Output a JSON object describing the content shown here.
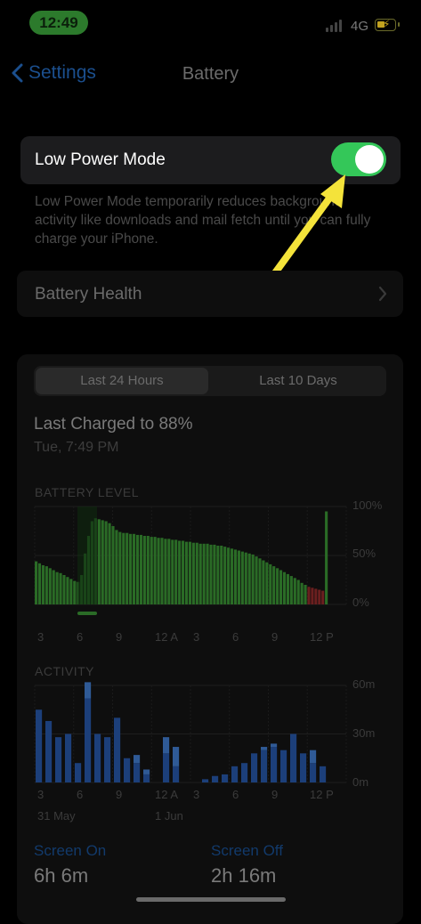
{
  "status": {
    "time": "12:49",
    "network": "4G"
  },
  "nav": {
    "back_label": "Settings",
    "title": "Battery"
  },
  "low_power": {
    "label": "Low Power Mode",
    "enabled": true,
    "description": "Low Power Mode temporarily reduces background activity like downloads and mail fetch until you can fully charge your iPhone."
  },
  "battery_health": {
    "label": "Battery Health"
  },
  "tabs": [
    "Last 24 Hours",
    "Last 10 Days"
  ],
  "last_charged": {
    "title": "Last Charged to 88%",
    "time": "Tue, 7:49 PM"
  },
  "battery_level": {
    "title": "BATTERY LEVEL",
    "y_ticks": [
      "100%",
      "50%",
      "0%"
    ]
  },
  "activity": {
    "title": "ACTIVITY",
    "y_ticks": [
      "60m",
      "30m",
      "0m"
    ]
  },
  "x_ticks": [
    "3",
    "6",
    "9",
    "12 A",
    "3",
    "6",
    "9",
    "12 P"
  ],
  "dates": [
    "31 May",
    "1 Jun"
  ],
  "screen_on": {
    "label": "Screen On",
    "value": "6h 6m"
  },
  "screen_off": {
    "label": "Screen Off",
    "value": "2h 16m"
  },
  "colors": {
    "green": "#2a6b26",
    "red": "#6b1f1f",
    "blue": "#1c3f7a",
    "blue_light": "#2f5a96",
    "toggle": "#34c759",
    "arrow": "#f4e33a"
  },
  "chart_data": [
    {
      "type": "bar",
      "title": "BATTERY LEVEL",
      "x_ticks": [
        "3",
        "6",
        "9",
        "12 A",
        "3",
        "6",
        "9",
        "12 P"
      ],
      "ylim": [
        0,
        100
      ],
      "values": [
        44,
        42,
        40,
        39,
        37,
        35,
        33,
        32,
        30,
        28,
        26,
        24,
        23,
        30,
        52,
        70,
        85,
        88,
        87,
        86,
        85,
        83,
        80,
        76,
        74,
        73,
        73,
        72,
        72,
        71,
        71,
        70,
        70,
        69,
        69,
        68,
        68,
        67,
        67,
        66,
        66,
        65,
        65,
        64,
        64,
        63,
        63,
        62,
        62,
        62,
        61,
        61,
        60,
        60,
        59,
        58,
        57,
        56,
        55,
        54,
        53,
        52,
        51,
        49,
        47,
        45,
        43,
        41,
        39,
        37,
        35,
        33,
        31,
        29,
        27,
        25,
        22,
        20,
        18,
        17,
        16,
        15,
        14,
        95
      ]
    },
    {
      "type": "bar",
      "title": "ACTIVITY",
      "x_ticks": [
        "3",
        "6",
        "9",
        "12 A",
        "3",
        "6",
        "9",
        "12 P"
      ],
      "ylim": [
        0,
        60
      ],
      "screen_on": [
        45,
        38,
        28,
        30,
        12,
        52,
        30,
        28,
        40,
        15,
        12,
        5,
        0,
        18,
        10,
        0,
        0,
        2,
        4,
        5,
        10,
        12,
        18,
        20,
        22,
        20,
        30,
        18,
        12,
        10
      ],
      "screen_off": [
        0,
        0,
        0,
        0,
        0,
        10,
        0,
        0,
        0,
        0,
        5,
        3,
        0,
        10,
        12,
        0,
        0,
        0,
        0,
        0,
        0,
        0,
        0,
        2,
        2,
        0,
        0,
        0,
        8,
        0
      ]
    }
  ]
}
